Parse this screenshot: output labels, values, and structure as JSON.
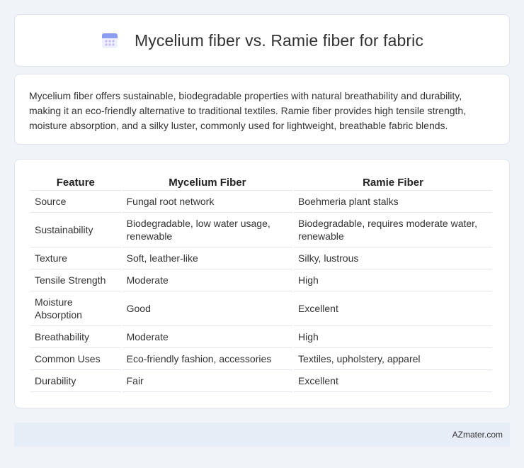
{
  "header": {
    "title": "Mycelium fiber vs. Ramie fiber for fabric",
    "icon": "calendar-icon",
    "accent": "#7c8df0"
  },
  "description": {
    "text": "Mycelium fiber offers sustainable, biodegradable properties with natural breathability and durability, making it an eco-friendly alternative to traditional textiles. Ramie fiber provides high tensile strength, moisture absorption, and a silky luster, commonly used for lightweight, breathable fabric blends."
  },
  "table": {
    "headers": [
      "Feature",
      "Mycelium Fiber",
      "Ramie Fiber"
    ],
    "rows": [
      [
        "Source",
        "Fungal root network",
        "Boehmeria plant stalks"
      ],
      [
        "Sustainability",
        "Biodegradable, low water usage, renewable",
        "Biodegradable, requires moderate water, renewable"
      ],
      [
        "Texture",
        "Soft, leather-like",
        "Silky, lustrous"
      ],
      [
        "Tensile Strength",
        "Moderate",
        "High"
      ],
      [
        "Moisture Absorption",
        "Good",
        "Excellent"
      ],
      [
        "Breathability",
        "Moderate",
        "High"
      ],
      [
        "Common Uses",
        "Eco-friendly fashion, accessories",
        "Textiles, upholstery, apparel"
      ],
      [
        "Durability",
        "Fair",
        "Excellent"
      ]
    ]
  },
  "footer": {
    "brand": "AZmater.com"
  }
}
